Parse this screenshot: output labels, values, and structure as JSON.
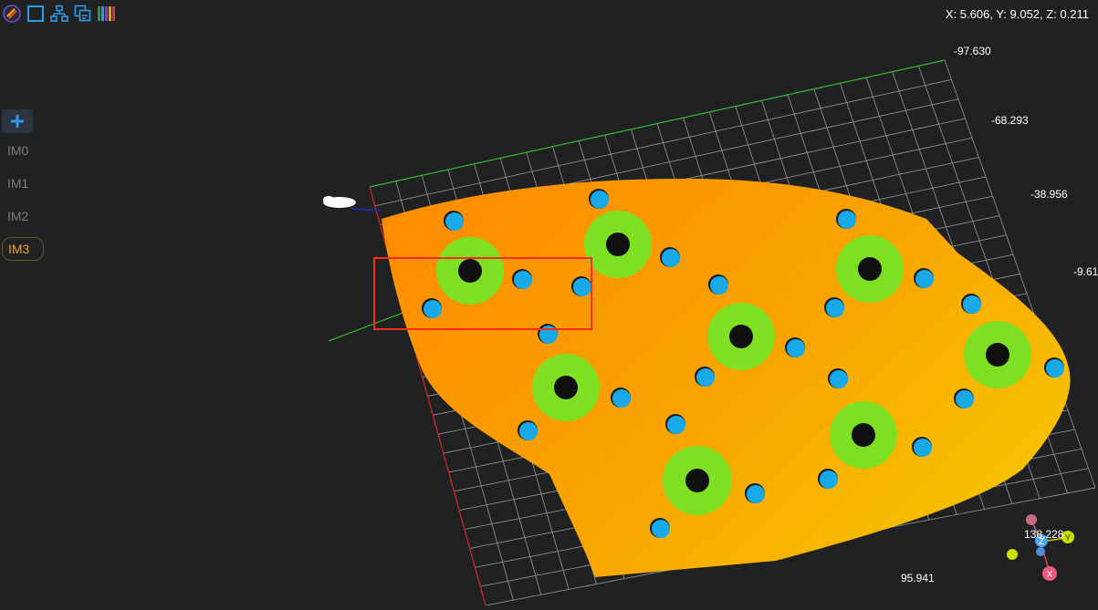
{
  "toolbar": {
    "items": [
      {
        "icon": "logo-icon"
      },
      {
        "icon": "square-select-icon"
      },
      {
        "icon": "hierarchy-icon"
      },
      {
        "icon": "copy-windows-icon"
      },
      {
        "icon": "color-bars-icon"
      }
    ]
  },
  "coords_readout": "X: 5.606, Y: 9.052, Z: 0.211",
  "left_panel": {
    "add_label": "+",
    "images": [
      "IM0",
      "IM1",
      "IM2",
      "IM3"
    ],
    "active": "IM3"
  },
  "axis_labels": {
    "y1": "-97.630",
    "y2": "-68.293",
    "y3": "-38.956",
    "y4": "-9.61",
    "x1": "95.941",
    "z1": "138.228"
  },
  "colors": {
    "background": "#202123",
    "grid": "#9a9a9a",
    "surface_high": "#f7a800",
    "surface_low": "#ff8a00",
    "ring": "#7ee022",
    "hole": "#19a8e8",
    "selection_box": "#ff2a1a",
    "active_tab": "#e9a23b"
  }
}
